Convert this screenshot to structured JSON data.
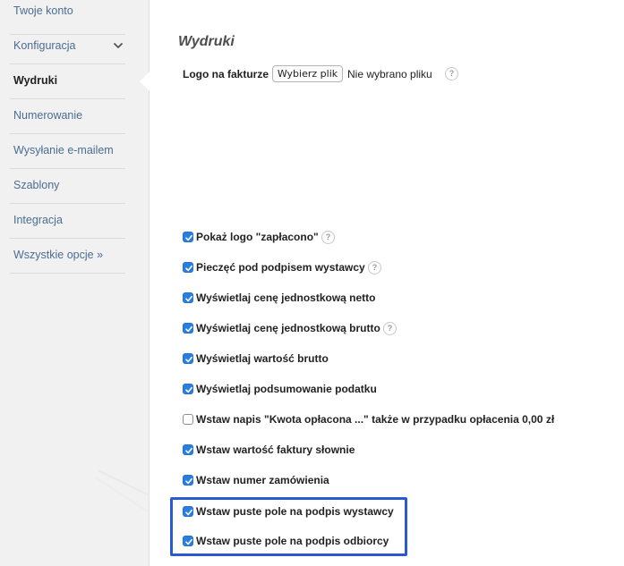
{
  "sidebar": {
    "items": [
      {
        "label": "Twoje konto",
        "active": false
      },
      {
        "label": "Konfiguracja",
        "active": false,
        "icon": "chevron-down-icon"
      },
      {
        "label": "Wydruki",
        "active": true
      },
      {
        "label": "Numerowanie",
        "active": false
      },
      {
        "label": "Wysyłanie e-mailem",
        "active": false
      },
      {
        "label": "Szablony",
        "active": false
      },
      {
        "label": "Integracja",
        "active": false
      },
      {
        "label": "Wszystkie opcje »",
        "active": false
      }
    ]
  },
  "main": {
    "title": "Wydruki",
    "logo": {
      "label": "Logo na fakturze",
      "button": "Wybierz plik",
      "status": "Nie wybrano pliku",
      "help": "?"
    },
    "options": [
      {
        "label": "Pokaż logo \"zapłacono\"",
        "checked": true,
        "help": "?"
      },
      {
        "label": "Pieczęć pod podpisem wystawcy",
        "checked": true,
        "help": "?"
      },
      {
        "label": "Wyświetlaj cenę jednostkową netto",
        "checked": true
      },
      {
        "label": "Wyświetlaj cenę jednostkową brutto",
        "checked": true,
        "help": "?"
      },
      {
        "label": "Wyświetlaj wartość brutto",
        "checked": true
      },
      {
        "label": "Wyświetlaj podsumowanie podatku",
        "checked": true
      },
      {
        "label": "Wstaw napis \"Kwota opłacona ...\" także w przypadku opłacenia 0,00 zł",
        "checked": false
      },
      {
        "label": "Wstaw wartość faktury słownie",
        "checked": true
      },
      {
        "label": "Wstaw numer zamówienia",
        "checked": true
      },
      {
        "label": "Wstaw puste pole na podpis wystawcy",
        "checked": true
      },
      {
        "label": "Wstaw puste pole na podpis odbiorcy",
        "checked": true
      }
    ]
  },
  "colors": {
    "accent": "#2a7ee0",
    "link": "#4a6d91",
    "highlight": "#2a5ad1",
    "sidebar_bg": "#f1f1f1"
  }
}
